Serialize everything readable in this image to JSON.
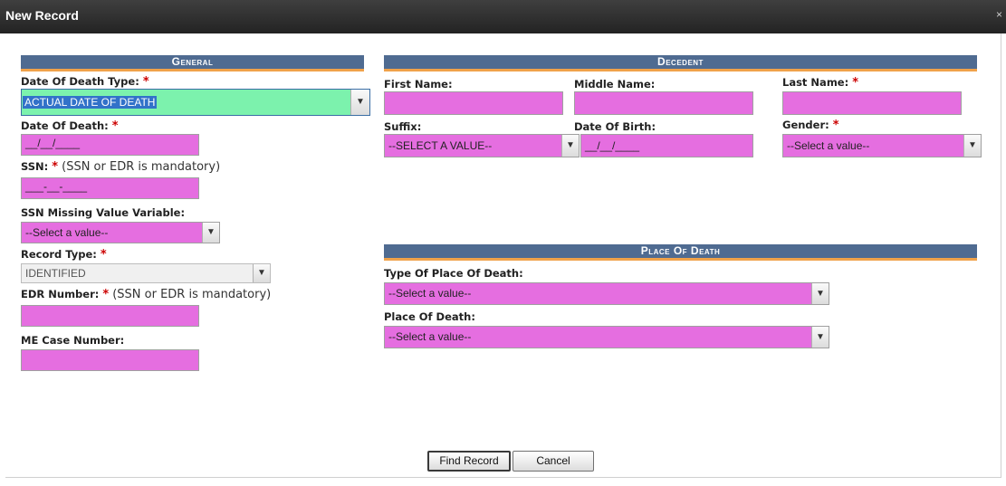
{
  "window": {
    "title": "New Record",
    "close_glyph": "×"
  },
  "general": {
    "heading": "General",
    "death_type_label": "Date Of Death Type:",
    "death_type_value": "ACTUAL DATE OF DEATH",
    "date_of_death_label": "Date Of Death:",
    "date_of_death_value": "__/__/____",
    "ssn_label": "SSN:",
    "ssn_note": "(SSN or EDR is mandatory)",
    "ssn_value": "___-__-____",
    "ssn_missing_label": "SSN Missing Value Variable:",
    "ssn_missing_value": "--Select a value--",
    "record_type_label": "Record Type:",
    "record_type_value": "IDENTIFIED",
    "edr_label": "EDR Number:",
    "edr_note": "(SSN or EDR is mandatory)",
    "edr_value": "",
    "me_case_label": "ME Case Number:",
    "me_case_value": ""
  },
  "decedent": {
    "heading": "Decedent",
    "first_name_label": "First Name:",
    "first_name_value": "",
    "middle_name_label": "Middle Name:",
    "middle_name_value": "",
    "last_name_label": "Last Name:",
    "last_name_value": "",
    "suffix_label": "Suffix:",
    "suffix_value": "--SELECT A VALUE--",
    "dob_label": "Date Of Birth:",
    "dob_value": "__/__/____",
    "gender_label": "Gender:",
    "gender_value": "--Select a value--"
  },
  "place_of_death": {
    "heading": "Place Of Death",
    "type_label": "Type Of Place Of Death:",
    "type_value": "--Select a value--",
    "place_label": "Place Of Death:",
    "place_value": "--Select a value--"
  },
  "required_marker": "*",
  "dropdown_glyph": "▼",
  "buttons": {
    "find": "Find Record",
    "cancel": "Cancel"
  },
  "colors": {
    "required_field": "#e56ee0",
    "selected_field": "#7cf2ad",
    "section_header": "#4f6b91",
    "section_underline": "#f0a24a"
  }
}
